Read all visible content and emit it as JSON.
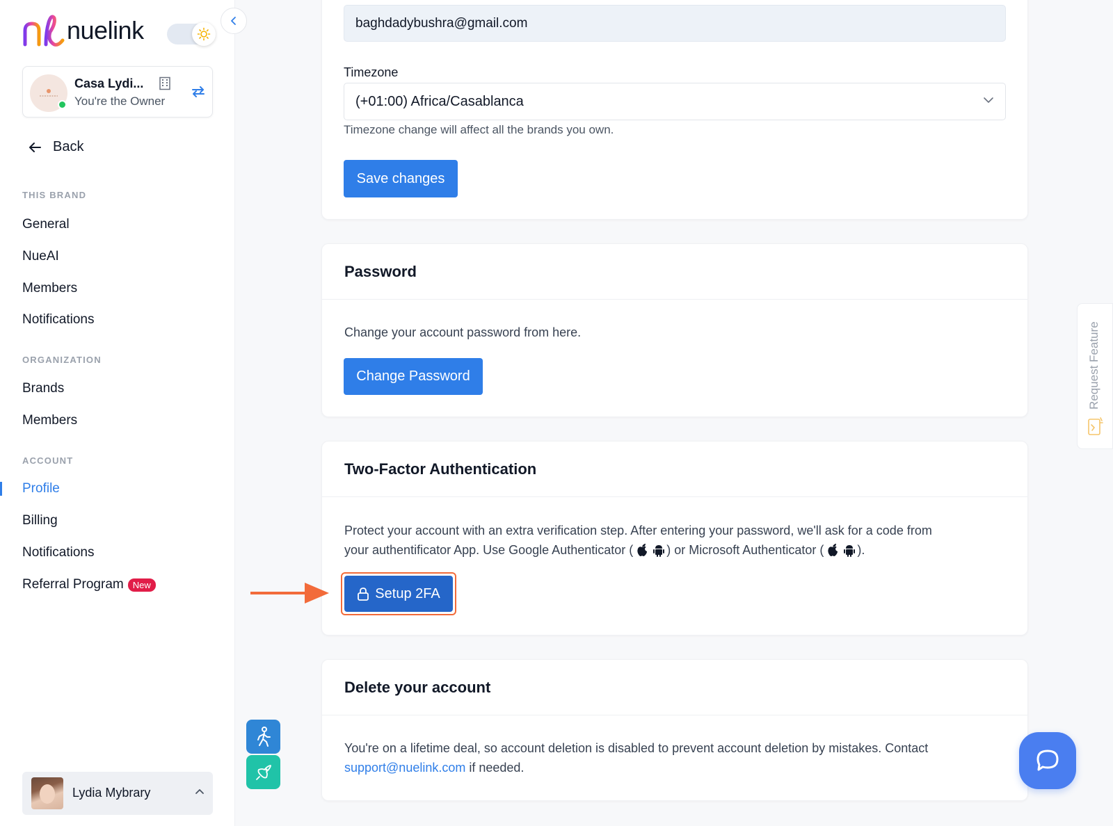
{
  "app": {
    "name": "nuelink"
  },
  "brand": {
    "name": "Casa Lydi...",
    "role": "You're the Owner"
  },
  "nav": {
    "back": "Back",
    "sections": [
      {
        "label": "THIS BRAND",
        "items": [
          "General",
          "NueAI",
          "Members",
          "Notifications"
        ]
      },
      {
        "label": "ORGANIZATION",
        "items": [
          "Brands",
          "Members"
        ]
      },
      {
        "label": "ACCOUNT",
        "items": [
          "Profile",
          "Billing",
          "Notifications",
          "Referral Program"
        ]
      }
    ],
    "active": "Profile",
    "new_badge": "New"
  },
  "user": {
    "name": "Lydia Mybrary"
  },
  "profile": {
    "email": "baghdadybushra@gmail.com",
    "timezone_label": "Timezone",
    "timezone_value": "(+01:00) Africa/Casablanca",
    "timezone_help": "Timezone change will affect all the brands you own.",
    "save_label": "Save changes"
  },
  "password": {
    "title": "Password",
    "description": "Change your account password from here.",
    "button": "Change Password"
  },
  "twofa": {
    "title": "Two-Factor Authentication",
    "line1": "Protect your account with an extra verification step. After entering your password, we'll ask for a code from",
    "line2_a": "your authentificator App. Use Google Authenticator (",
    "line2_b": ") or Microsoft Authenticator (",
    "line2_c": ").",
    "button": "Setup 2FA"
  },
  "delete": {
    "title": "Delete your account",
    "line1": "You're on a lifetime deal, so account deletion is disabled to prevent account deletion by mistakes. Contact",
    "email": "support@nuelink.com",
    "line2": " if needed."
  },
  "request_feature": "Request Feature",
  "colors": {
    "primary": "#2f7ee8",
    "highlight": "#f26b3a",
    "badge": "#e11d48",
    "chat": "#4a7ef0"
  }
}
